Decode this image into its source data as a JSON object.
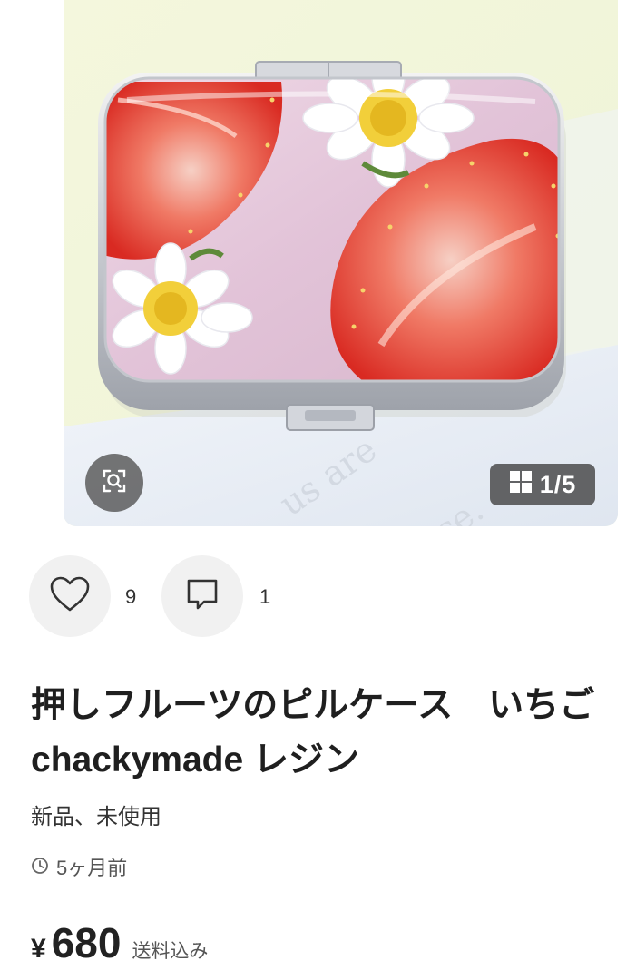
{
  "gallery": {
    "current": "1",
    "separator": "/",
    "total": "5"
  },
  "actions": {
    "likes_count": "9",
    "comments_count": "1"
  },
  "product": {
    "title": "押しフルーツのピルケース　いちご　chackymade レジン",
    "condition": "新品、未使用",
    "posted": "5ヶ月前",
    "price_symbol": "¥",
    "price": "680",
    "shipping_note": "送料込み"
  },
  "icons": {
    "zoom": "zoom-search-icon",
    "gallery": "grid-icon",
    "like": "heart-icon",
    "comment": "comment-bubble-icon",
    "time": "clock-icon"
  },
  "colors": {
    "photo_background": "#f7f8e6",
    "case_lid": "#e8cfe0",
    "strawberry": "#e63a2e",
    "overlay": "#4a4a4a",
    "action_circle": "#f1f1f1"
  }
}
